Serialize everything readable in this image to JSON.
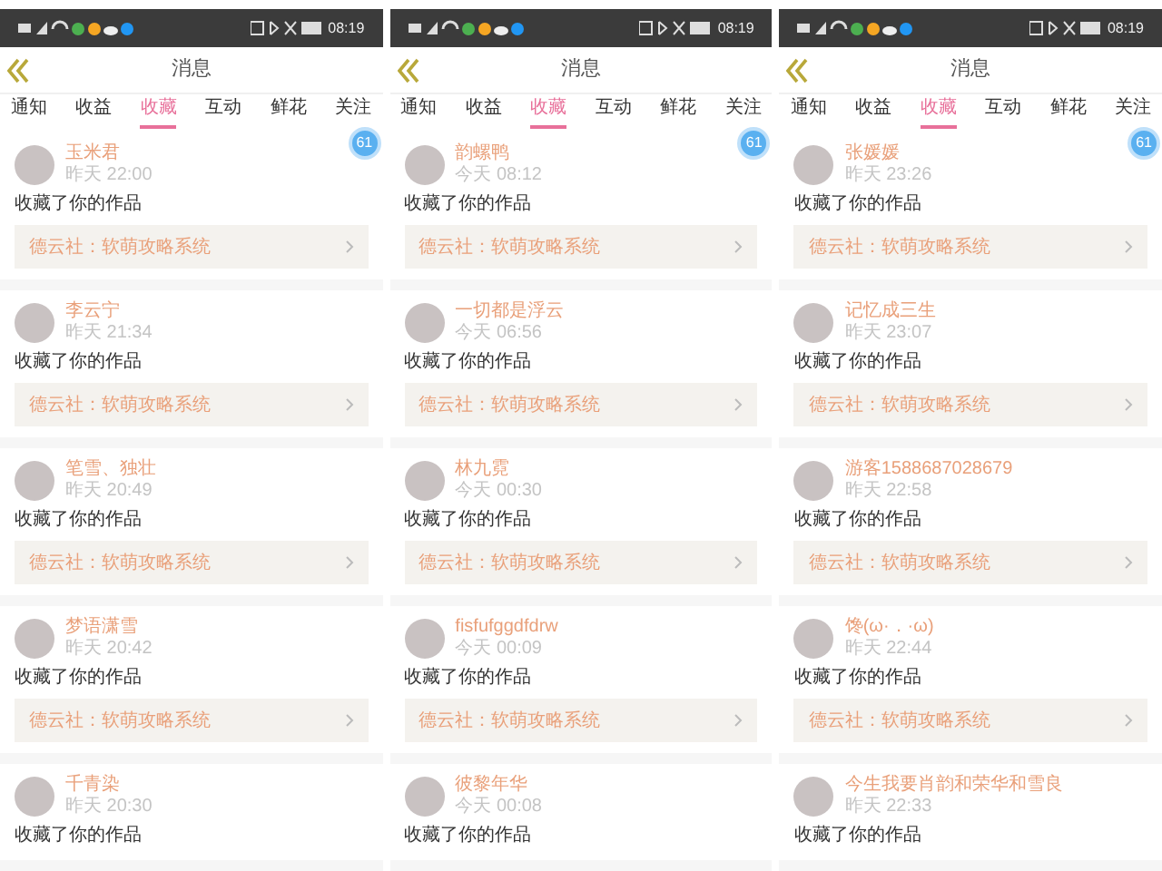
{
  "screens": [
    {
      "status_bar": {
        "time": "08:19"
      },
      "header": {
        "title": "消息"
      },
      "tabs": [
        {
          "label": "通知",
          "selected": false
        },
        {
          "label": "收益",
          "selected": false
        },
        {
          "label": "收藏",
          "selected": true
        },
        {
          "label": "互动",
          "selected": false
        },
        {
          "label": "鲜花",
          "selected": false
        },
        {
          "label": "关注",
          "selected": false
        }
      ],
      "badge": "61",
      "items": [
        {
          "name": "玉米君",
          "time": "昨天 22:00",
          "text": "收藏了你的作品",
          "link": "德云社：软萌攻略系统"
        },
        {
          "name": "李云宁",
          "time": "昨天 21:34",
          "text": "收藏了你的作品",
          "link": "德云社：软萌攻略系统"
        },
        {
          "name": "笔雪、独壮",
          "time": "昨天 20:49",
          "text": "收藏了你的作品",
          "link": "德云社：软萌攻略系统"
        },
        {
          "name": "梦语潇雪",
          "time": "昨天 20:42",
          "text": "收藏了你的作品",
          "link": "德云社：软萌攻略系统"
        },
        {
          "name": "千青染",
          "time": "昨天 20:30",
          "text": "收藏了你的作品"
        }
      ]
    },
    {
      "status_bar": {
        "time": "08:19"
      },
      "header": {
        "title": "消息"
      },
      "tabs": [
        {
          "label": "通知",
          "selected": false
        },
        {
          "label": "收益",
          "selected": false
        },
        {
          "label": "收藏",
          "selected": true
        },
        {
          "label": "互动",
          "selected": false
        },
        {
          "label": "鲜花",
          "selected": false
        },
        {
          "label": "关注",
          "selected": false
        }
      ],
      "badge": "61",
      "items": [
        {
          "name": "韵螺鸭",
          "time": "今天 08:12",
          "text": "收藏了你的作品",
          "link": "德云社：软萌攻略系统"
        },
        {
          "name": "一切都是浮云",
          "time": "今天 06:56",
          "text": "收藏了你的作品",
          "link": "德云社：软萌攻略系统"
        },
        {
          "name": "林九霓",
          "time": "今天 00:30",
          "text": "收藏了你的作品",
          "link": "德云社：软萌攻略系统"
        },
        {
          "name": "fisfufggdfdrw",
          "time": "今天 00:09",
          "text": "收藏了你的作品",
          "link": "德云社：软萌攻略系统"
        },
        {
          "name": "彼黎年华",
          "time": "今天 00:08",
          "text": "收藏了你的作品"
        }
      ]
    },
    {
      "status_bar": {
        "time": "08:19"
      },
      "header": {
        "title": "消息"
      },
      "tabs": [
        {
          "label": "通知",
          "selected": false
        },
        {
          "label": "收益",
          "selected": false
        },
        {
          "label": "收藏",
          "selected": true
        },
        {
          "label": "互动",
          "selected": false
        },
        {
          "label": "鲜花",
          "selected": false
        },
        {
          "label": "关注",
          "selected": false
        }
      ],
      "badge": "61",
      "items": [
        {
          "name": "张媛媛",
          "time": "昨天 23:26",
          "text": "收藏了你的作品",
          "link": "德云社：软萌攻略系统"
        },
        {
          "name": "记忆成三生",
          "time": "昨天 23:07",
          "text": "收藏了你的作品",
          "link": "德云社：软萌攻略系统"
        },
        {
          "name": "游客1588687028679",
          "time": "昨天 22:58",
          "text": "收藏了你的作品",
          "link": "德云社：软萌攻略系统"
        },
        {
          "name": "馋(ω·．·ω)",
          "time": "昨天 22:44",
          "text": "收藏了你的作品",
          "link": "德云社：软萌攻略系统"
        },
        {
          "name": "今生我要肖韵和荣华和雪良",
          "time": "昨天 22:33",
          "text": "收藏了你的作品"
        }
      ]
    }
  ]
}
